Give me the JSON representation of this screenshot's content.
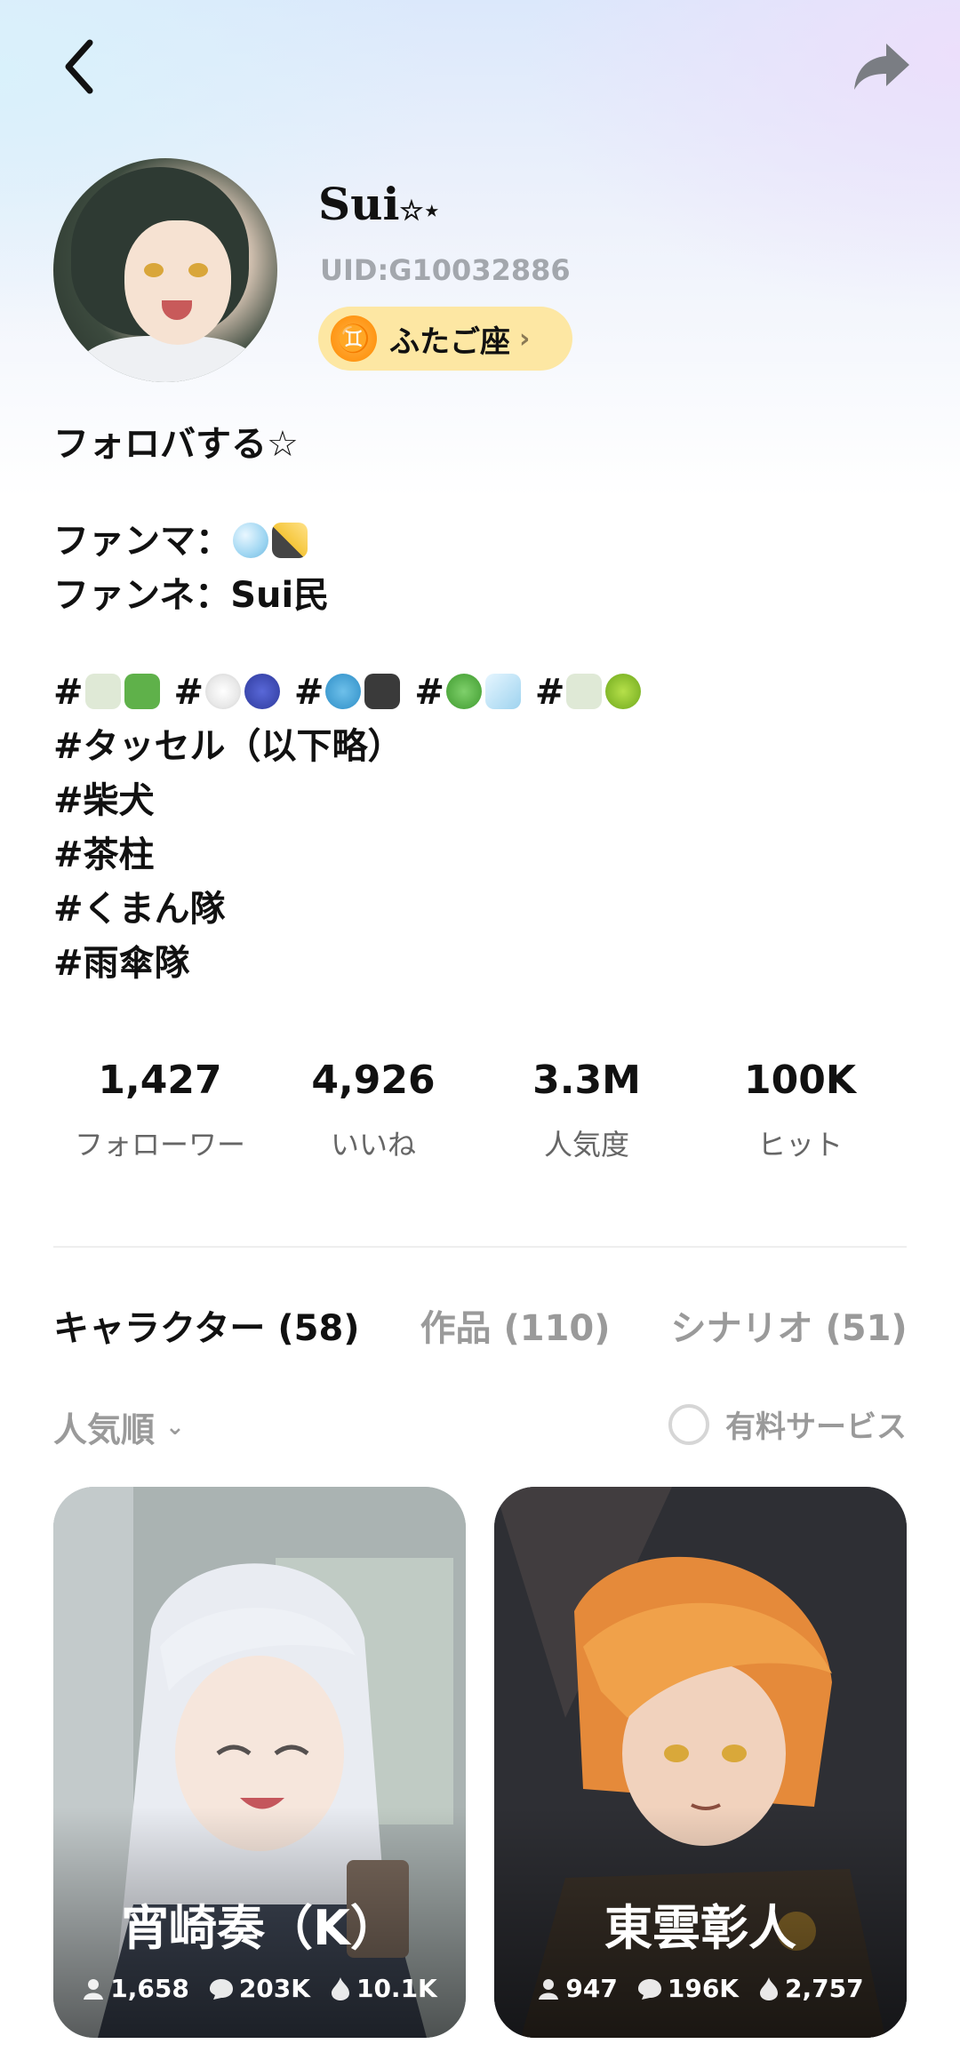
{
  "profile": {
    "name": "Sui",
    "name_suffix": "☆⋆",
    "uid": "UID:G10032886",
    "zodiac": {
      "symbol": "♊",
      "label": "ふたご座"
    }
  },
  "bio": {
    "line1": "フォロバする☆",
    "fanmark_label": "ファンマ：",
    "fanname": "ファンネ：Sui民",
    "tags_emoji_prefix": "#",
    "tags": [
      "#タッセル（以下略）",
      "#柴犬",
      "#茶柱",
      "#くまん隊",
      "#雨傘隊"
    ]
  },
  "stats": [
    {
      "value": "1,427",
      "label": "フォローワー"
    },
    {
      "value": "4,926",
      "label": "いいね"
    },
    {
      "value": "3.3M",
      "label": "人気度"
    },
    {
      "value": "100K",
      "label": "ヒット"
    }
  ],
  "tabs": [
    "キャラクター (58)",
    "作品 (110)",
    "シナリオ (51)"
  ],
  "sort_label": "人気順",
  "paid_label": "有料サービス",
  "cards": [
    {
      "title": "宵崎奏（K）",
      "users": "1,658",
      "chats": "203K",
      "likes": "10.1K"
    },
    {
      "title": "東雲彰人",
      "users": "947",
      "chats": "196K",
      "likes": "2,757"
    }
  ],
  "colors": {
    "accent_badge": "#fde7a3",
    "zodiac_icon": "#ff8a00"
  },
  "icons": [
    "back-arrow-icon",
    "share-icon",
    "zodiac-gemini-icon",
    "chevron-right-icon",
    "chevron-down-icon",
    "user-icon",
    "chat-bubble-icon",
    "flame-icon"
  ]
}
